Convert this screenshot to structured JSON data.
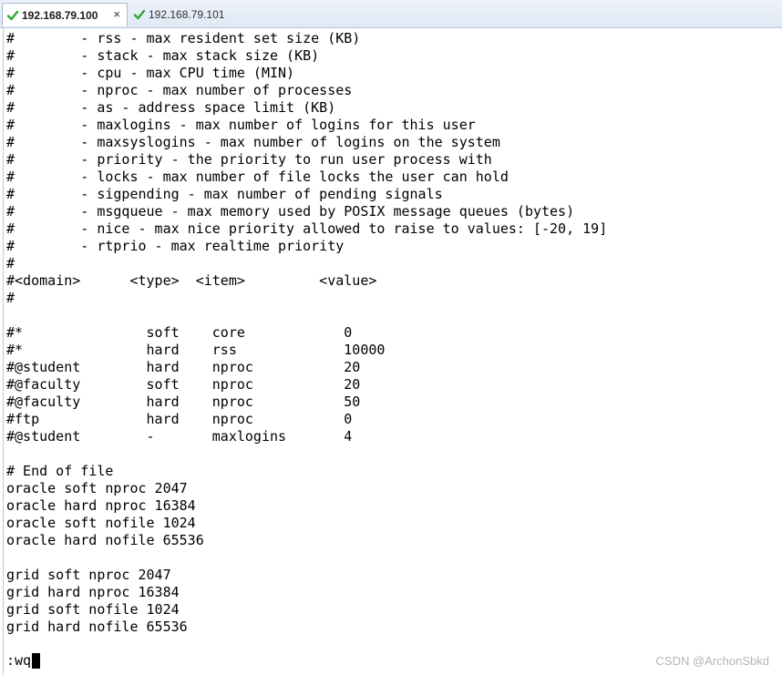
{
  "tabs": [
    {
      "label": "192.168.79.100",
      "active": true,
      "close": "×"
    },
    {
      "label": "192.168.79.101",
      "active": false
    }
  ],
  "terminal": {
    "lines": [
      "#        - rss - max resident set size (KB)",
      "#        - stack - max stack size (KB)",
      "#        - cpu - max CPU time (MIN)",
      "#        - nproc - max number of processes",
      "#        - as - address space limit (KB)",
      "#        - maxlogins - max number of logins for this user",
      "#        - maxsyslogins - max number of logins on the system",
      "#        - priority - the priority to run user process with",
      "#        - locks - max number of file locks the user can hold",
      "#        - sigpending - max number of pending signals",
      "#        - msgqueue - max memory used by POSIX message queues (bytes)",
      "#        - nice - max nice priority allowed to raise to values: [-20, 19]",
      "#        - rtprio - max realtime priority",
      "#",
      "#<domain>      <type>  <item>         <value>",
      "#",
      "",
      "#*               soft    core            0",
      "#*               hard    rss             10000",
      "#@student        hard    nproc           20",
      "#@faculty        soft    nproc           20",
      "#@faculty        hard    nproc           50",
      "#ftp             hard    nproc           0",
      "#@student        -       maxlogins       4",
      "",
      "# End of file",
      "oracle soft nproc 2047",
      "oracle hard nproc 16384",
      "oracle soft nofile 1024",
      "oracle hard nofile 65536",
      "",
      "grid soft nproc 2047",
      "grid hard nproc 16384",
      "grid soft nofile 1024",
      "grid hard nofile 65536"
    ],
    "command": ":wq"
  },
  "watermark": "CSDN @ArchonSbkd",
  "colors": {
    "check": "#2fa82f",
    "tabbar": "#dfe8f5"
  }
}
